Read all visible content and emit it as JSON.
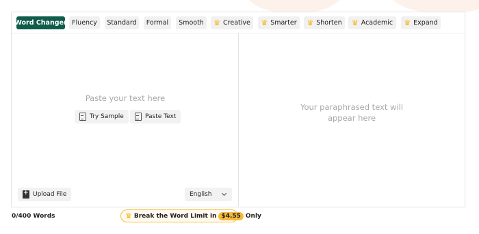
{
  "modes": [
    {
      "label": "Word Changer",
      "active": true,
      "premium": false
    },
    {
      "label": "Fluency",
      "active": false,
      "premium": false
    },
    {
      "label": "Standard",
      "active": false,
      "premium": false
    },
    {
      "label": "Formal",
      "active": false,
      "premium": false
    },
    {
      "label": "Smooth",
      "active": false,
      "premium": false
    },
    {
      "label": "Creative",
      "active": false,
      "premium": true
    },
    {
      "label": "Smarter",
      "active": false,
      "premium": true
    },
    {
      "label": "Shorten",
      "active": false,
      "premium": true
    },
    {
      "label": "Academic",
      "active": false,
      "premium": true
    },
    {
      "label": "Expand",
      "active": false,
      "premium": true
    }
  ],
  "input": {
    "placeholder": "Paste your text here",
    "try_sample": "Try Sample",
    "paste_text": "Paste Text",
    "upload_file": "Upload File",
    "language": "English"
  },
  "output": {
    "placeholder_line1": "Your paraphrased text will",
    "placeholder_line2": "appear here"
  },
  "footer": {
    "word_count": "0/400 Words",
    "upsell_text": "Break the Word Limit in",
    "upsell_price": "$4.55",
    "upsell_suffix": "Only"
  },
  "colors": {
    "active_mode": "#0f5c4b",
    "crown": "#f2b40a",
    "price_badge": "#f6b93b"
  }
}
